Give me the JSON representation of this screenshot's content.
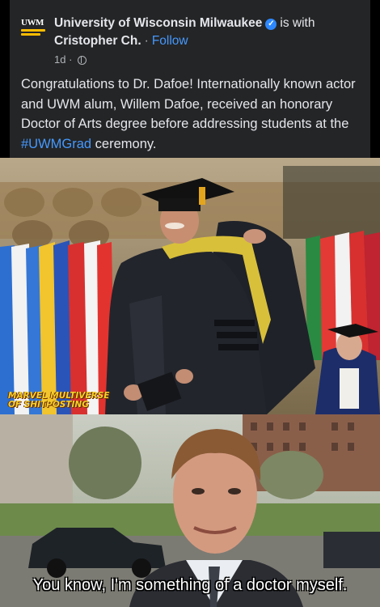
{
  "post": {
    "logo_text": "UWM",
    "author": "University of Wisconsin Milwaukee",
    "is_with": "is with",
    "with_person": "Cristopher Ch.",
    "separator": "·",
    "follow_label": "Follow",
    "timestamp": "1d",
    "audience_icon": "globe-icon",
    "text_before_hashtag": "Congratulations to Dr. Dafoe! Internationally known actor and UWM alum, Willem Dafoe, received an honorary Doctor of Arts degree before addressing students at the ",
    "hashtag": "#UWMGrad",
    "text_after_hashtag": " ceremony."
  },
  "meme": {
    "watermark_line1": "MARVEL MULTIVERSE",
    "watermark_line2": "OF SHITPOSTING",
    "caption": "You know, I'm something of a doctor myself."
  },
  "colors": {
    "card_bg": "#242526",
    "link": "#4599ff",
    "verified": "#2d88ff",
    "logo_gold": "#ffbd00"
  }
}
